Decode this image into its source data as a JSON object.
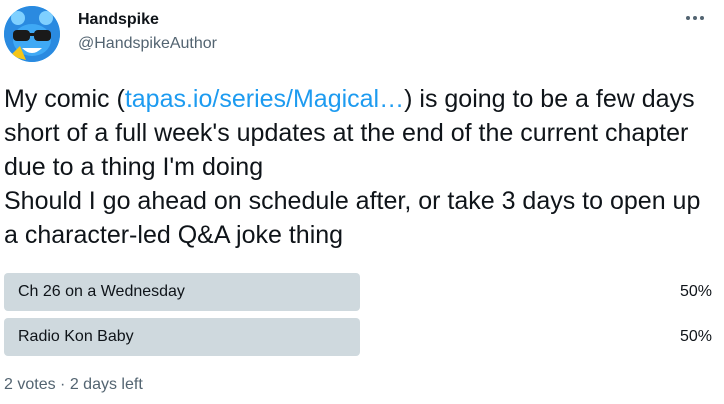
{
  "author": {
    "name": "Handspike",
    "handle": "@HandspikeAuthor"
  },
  "tweet": {
    "line1_pre": "My comic (",
    "link": "tapas.io/series/Magical…",
    "line1_post": ") is going to be a few days short of a full week's updates at the end of the current chapter due to a thing I'm doing",
    "line2": "Should I go ahead on schedule after, or take 3 days to open up a character-led Q&A joke thing"
  },
  "poll": {
    "options": [
      {
        "label": "Ch 26 on a Wednesday",
        "percent": 50,
        "percent_label": "50%"
      },
      {
        "label": "Radio Kon Baby",
        "percent": 50,
        "percent_label": "50%"
      }
    ],
    "votes": "2 votes",
    "separator": "·",
    "time_left": "2 days left"
  },
  "colors": {
    "link": "#1d9bf0",
    "bar": "#cfd9de",
    "secondary_text": "#536471"
  },
  "icons": {
    "more": "more-horizontal-icon",
    "avatar": "avatar-image"
  }
}
